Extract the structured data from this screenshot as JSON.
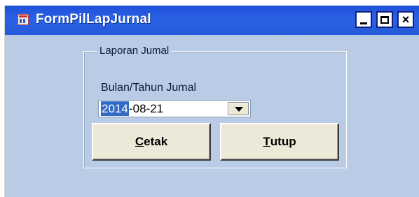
{
  "window": {
    "title": "FormPilLapJurnal",
    "icon": "form-app-icon",
    "controls": {
      "minimize": "minimize-icon",
      "maximize": "maximize-icon",
      "close": "×"
    }
  },
  "group": {
    "title": "Laporan Jumal",
    "field_label": "Bulan/Tahun Jumal",
    "date_value": {
      "year": "2014",
      "rest": "-08-21"
    }
  },
  "buttons": {
    "cetak": {
      "accel": "C",
      "rest": "etak"
    },
    "tutup": {
      "accel": "T",
      "rest": "utup"
    }
  }
}
